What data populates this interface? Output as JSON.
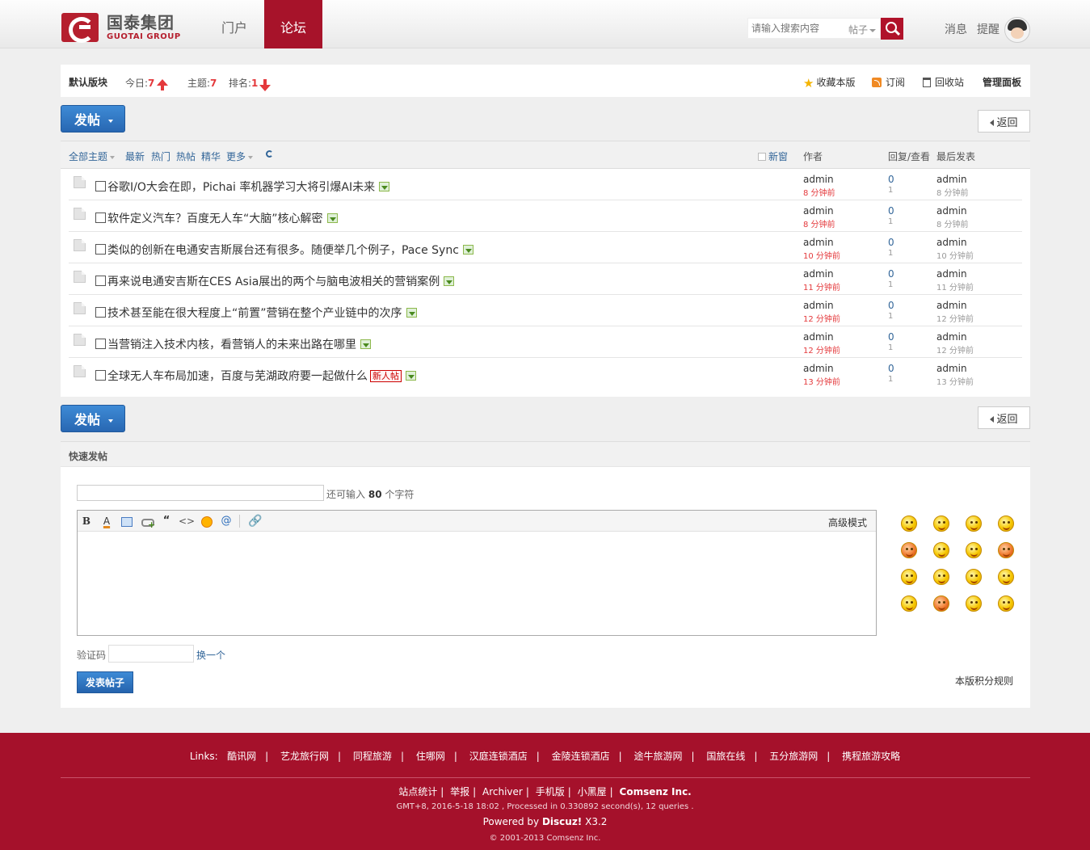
{
  "header": {
    "logo_cn": "国泰集团",
    "logo_en": "GUOTAI GROUP",
    "nav": [
      {
        "label": "门户",
        "active": false
      },
      {
        "label": "论坛",
        "active": true
      }
    ],
    "search": {
      "placeholder": "请输入搜索内容",
      "type": "帖子"
    },
    "links": {
      "messages": "消息",
      "remind": "提醒"
    }
  },
  "board": {
    "name": "默认版块",
    "today_label": "今日:",
    "today_value": "7",
    "topics_label": "主题:",
    "topics_value": "7",
    "rank_label": "排名:",
    "rank_value": "1",
    "actions": {
      "favorite": "收藏本版",
      "subscribe": "订阅",
      "recycle": "回收站",
      "admin": "管理面板"
    }
  },
  "buttons": {
    "post": "发帖",
    "back": "返回"
  },
  "filters": {
    "all": "全部主题",
    "latest": "最新",
    "hot": "热门",
    "hot_posts": "热帖",
    "digest": "精华",
    "more": "更多",
    "new_window": "新窗"
  },
  "columns": {
    "author": "作者",
    "replies_views": "回复/查看",
    "last_post": "最后发表"
  },
  "threads": [
    {
      "title": "谷歌I/O大会在即，Pichai 率机器学习大将引爆AI未来",
      "author": "admin",
      "author_time": "8 分钟前",
      "replies": "0",
      "views": "1",
      "last_user": "admin",
      "last_time": "8 分钟前",
      "badge": ""
    },
    {
      "title": "软件定义汽车？百度无人车“大脑”核心解密",
      "author": "admin",
      "author_time": "8 分钟前",
      "replies": "0",
      "views": "1",
      "last_user": "admin",
      "last_time": "8 分钟前",
      "badge": ""
    },
    {
      "title": "类似的创新在电通安吉斯展台还有很多。随便举几个例子，Pace Sync",
      "author": "admin",
      "author_time": "10 分钟前",
      "replies": "0",
      "views": "1",
      "last_user": "admin",
      "last_time": "10 分钟前",
      "badge": ""
    },
    {
      "title": "再来说电通安吉斯在CES Asia展出的两个与脑电波相关的营销案例",
      "author": "admin",
      "author_time": "11 分钟前",
      "replies": "0",
      "views": "1",
      "last_user": "admin",
      "last_time": "11 分钟前",
      "badge": ""
    },
    {
      "title": "技术甚至能在很大程度上“前置”营销在整个产业链中的次序",
      "author": "admin",
      "author_time": "12 分钟前",
      "replies": "0",
      "views": "1",
      "last_user": "admin",
      "last_time": "12 分钟前",
      "badge": ""
    },
    {
      "title": "当营销注入技术内核，看营销人的未来出路在哪里",
      "author": "admin",
      "author_time": "12 分钟前",
      "replies": "0",
      "views": "1",
      "last_user": "admin",
      "last_time": "12 分钟前",
      "badge": ""
    },
    {
      "title": "全球无人车布局加速，百度与芜湖政府要一起做什么",
      "author": "admin",
      "author_time": "13 分钟前",
      "replies": "0",
      "views": "1",
      "last_user": "admin",
      "last_time": "13 分钟前",
      "badge": "新人帖"
    }
  ],
  "quick_post": {
    "title": "快速发帖",
    "char_hint_prefix": "还可输入",
    "char_count": "80",
    "char_hint_suffix": "个字符",
    "toolbar_bold": "B",
    "toolbar_color": "A",
    "toolbar_quote": "“",
    "toolbar_code": "<>",
    "toolbar_at": "@",
    "toolbar_attach": "🔗",
    "advanced": "高级模式",
    "captcha_label": "验证码",
    "captcha_refresh": "换一个",
    "submit": "发表帖子",
    "rules": "本版积分规则"
  },
  "footer": {
    "links_label": "Links:",
    "links": [
      "酷讯网",
      "艺龙旅行网",
      "同程旅游",
      "住哪网",
      "汉庭连锁酒店",
      "金陵连锁酒店",
      "途牛旅游网",
      "国旅在线",
      "五分旅游网",
      "携程旅游攻略"
    ],
    "nav": [
      "站点统计",
      "举报",
      "Archiver",
      "手机版",
      "小黑屋"
    ],
    "brand": "Comsenz Inc.",
    "stats": "GMT+8, 2016-5-18 18:02 , Processed in 0.330892 second(s), 12 queries .",
    "powered_prefix": "Powered by",
    "powered_name": "Discuz!",
    "powered_version": "X3.2",
    "copyright": "© 2001-2013 Comsenz Inc."
  },
  "colors": {
    "brand_red": "#a5112b",
    "link_blue": "#336699",
    "button_blue": "#2867b2",
    "time_red": "#e4393c"
  }
}
